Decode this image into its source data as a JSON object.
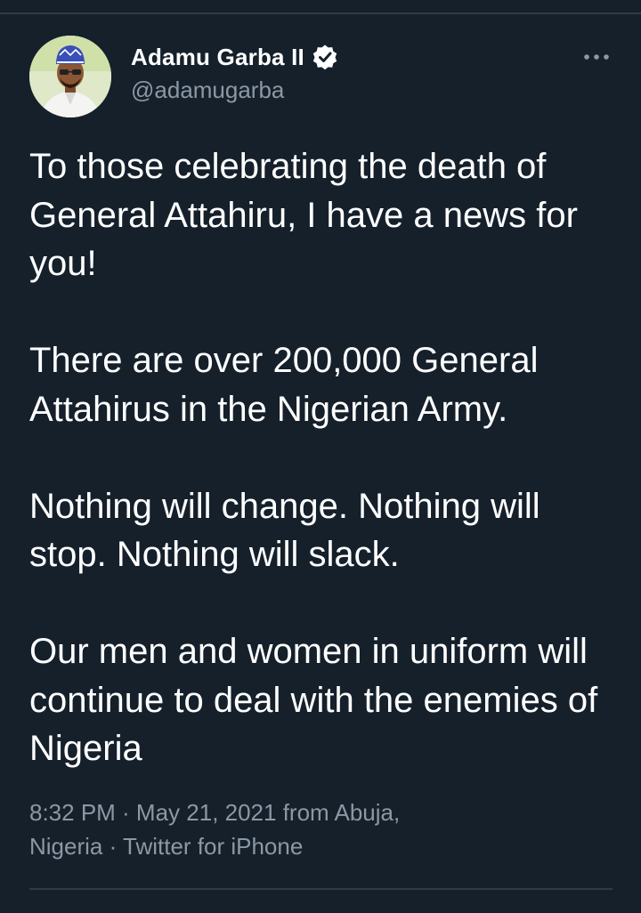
{
  "author": {
    "display_name": "Adamu Garba II",
    "handle": "@adamugarba",
    "verified": true,
    "avatar_icon": "user-avatar"
  },
  "more_icon": "ellipsis-icon",
  "tweet": {
    "paragraphs": [
      "To those celebrating the death of General Attahiru, I have a news for you!",
      "There are over 200,000 General Attahirus in the Nigerian Army.",
      "Nothing will change. Nothing will stop. Nothing will slack.",
      "Our men and women in uniform will continue to deal with the enemies of Nigeria"
    ]
  },
  "meta": {
    "line1": "8:32 PM · May 21, 2021 from Abuja,",
    "line2": "Nigeria · Twitter for iPhone"
  },
  "colors": {
    "background": "#15202b",
    "text": "#ffffff",
    "secondary_text": "#8b98a5",
    "divider": "#2f3b47"
  }
}
